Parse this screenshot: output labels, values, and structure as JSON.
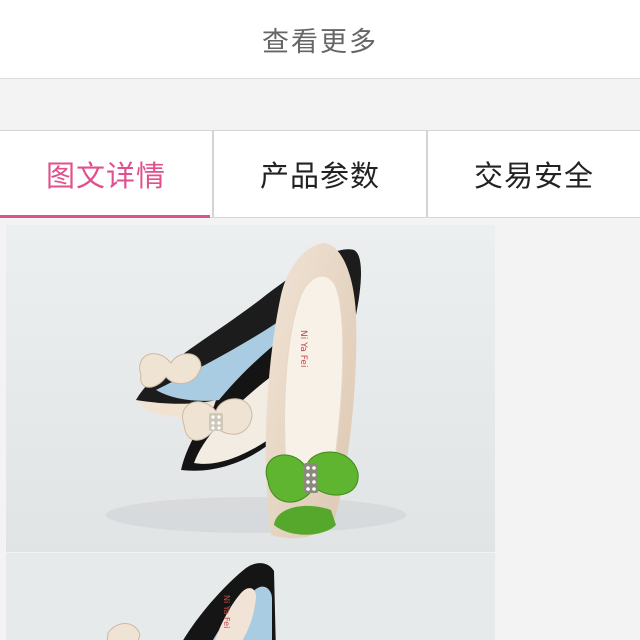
{
  "more_bar": {
    "label": "查看更多"
  },
  "tabs": [
    {
      "label": "图文详情",
      "active": true
    },
    {
      "label": "产品参数",
      "active": false
    },
    {
      "label": "交易安全",
      "active": false
    }
  ],
  "colors": {
    "accent": "#e0508c",
    "background": "#f4f3f3",
    "text": "#222222",
    "muted_text": "#666666"
  },
  "photos": [
    {
      "brand_text": "Ni Ya Fei"
    },
    {
      "brand_text": "Ni Ya Fei"
    }
  ]
}
